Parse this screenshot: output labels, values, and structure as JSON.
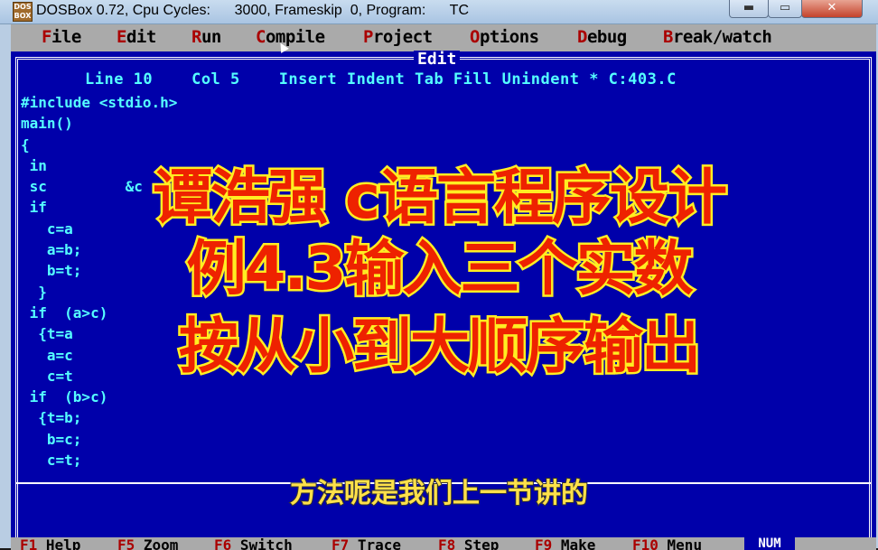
{
  "window": {
    "title": "DOSBox 0.72, Cpu Cycles:      3000, Frameskip  0, Program:      TC",
    "icon_text": "DOS BOX",
    "min_label": "▬",
    "max_label": "▭",
    "close_label": "✕"
  },
  "menu": [
    {
      "hotkey": "F",
      "rest": "ile"
    },
    {
      "hotkey": "E",
      "rest": "dit"
    },
    {
      "hotkey": "R",
      "rest": "un"
    },
    {
      "hotkey": "C",
      "rest": "ompile"
    },
    {
      "hotkey": "P",
      "rest": "roject"
    },
    {
      "hotkey": "O",
      "rest": "ptions"
    },
    {
      "hotkey": "D",
      "rest": "ebug"
    },
    {
      "hotkey": "B",
      "rest": "reak/watch"
    }
  ],
  "editor": {
    "window_title": "Edit",
    "status_line": "Line 10    Col 5    Insert Indent Tab Fill Unindent * C:403.C",
    "code_lines": [
      "#include <stdio.h>",
      "main()",
      "{",
      " in",
      " sc         &c",
      " if",
      "   c=a",
      "   a=b;",
      "   b=t;",
      "  }",
      " if  (a>c)",
      "  {t=a",
      "   a=c",
      "   c=t",
      " if  (b>c)",
      "  {t=b;",
      "   b=c;",
      "   c=t;"
    ]
  },
  "function_keys": [
    {
      "key": "F1",
      "label": " Help"
    },
    {
      "key": "F5",
      "label": " Zoom"
    },
    {
      "key": "F6",
      "label": " Switch"
    },
    {
      "key": "F7",
      "label": " Trace"
    },
    {
      "key": "F8",
      "label": " Step"
    },
    {
      "key": "F9",
      "label": " Make"
    },
    {
      "key": "F10",
      "label": " Menu"
    }
  ],
  "num_indicator": "NUM",
  "overlay": {
    "line1": "谭浩强 c语言程序设计",
    "line2": "例4.3输入三个实数",
    "line3": "按从小到大顺序输出",
    "subtitle": "方法呢是我们上一节讲的"
  }
}
